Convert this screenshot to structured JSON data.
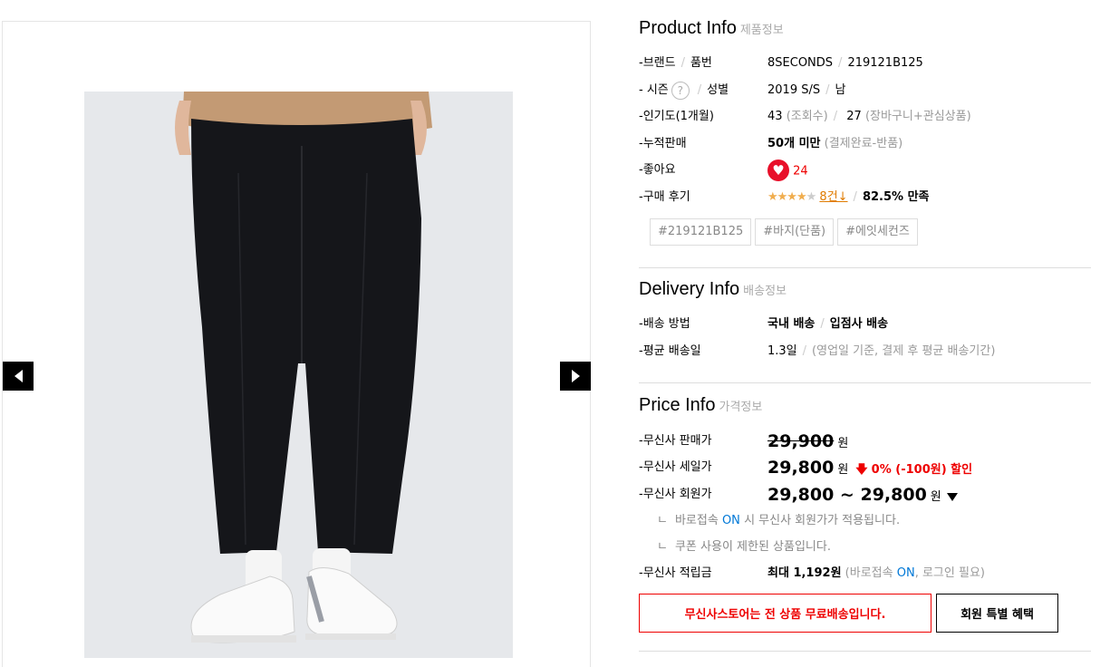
{
  "product_info": {
    "title": "Product Info",
    "subtitle": "제품정보",
    "rows": {
      "brand": {
        "label": "-브랜드",
        "label2": "품번",
        "brand": "8SECONDS",
        "code": "219121B125"
      },
      "season": {
        "label": "- 시즌",
        "help": "?",
        "label2": "성별",
        "season": "2019 S/S",
        "gender": "남"
      },
      "popularity": {
        "label": "-인기도(1개월)",
        "views": "43",
        "views_note": "(조회수)",
        "wish": "27",
        "wish_note": "(장바구니+관심상품)"
      },
      "sales": {
        "label": "-누적판매",
        "value": "50개 미만",
        "note": "(결제완료-반품)"
      },
      "likes": {
        "label": "-좋아요",
        "count": "24"
      },
      "reviews": {
        "label": "-구매 후기",
        "stars_on": "★★★★",
        "stars_off": "★",
        "count_link": "8건↓",
        "satisfaction": "82.5% 만족"
      }
    },
    "tags": [
      "#219121B125",
      "#바지(단품)",
      "#에잇세컨즈"
    ]
  },
  "delivery_info": {
    "title": "Delivery Info",
    "subtitle": "배송정보",
    "method_label": "-배송 방법",
    "method_1": "국내 배송",
    "method_2": "입점사 배송",
    "avg_label": "-평균 배송일",
    "avg_value": "1.3일",
    "avg_note": "(영업일 기준, 결제 후 평균 배송기간)"
  },
  "price_info": {
    "title": "Price Info",
    "subtitle": "가격정보",
    "list_label": "-무신사 판매가",
    "list_price": "29,900",
    "won": "원",
    "sale_label": "-무신사 세일가",
    "sale_price": "29,800",
    "discount": "0% (-100원) 할인",
    "member_label": "-무신사 회원가",
    "member_price": "29,800 ~ 29,800",
    "note1_pre": "바로접속",
    "note1_on": "ON",
    "note1_post": "시 무신사 회원가가 적용됩니다.",
    "note2": "쿠폰 사용이 제한된 상품입니다.",
    "points_label": "-무신사 적립금",
    "points_value": "최대 1,192원",
    "points_note_pre": "(바로접속",
    "points_note_on": "ON",
    "points_note_post": ", 로그인 필요)"
  },
  "buttons": {
    "free_shipping": "무신사스토어는 전 상품 무료배송입니다.",
    "member_benefit": "회원 특별 혜택"
  },
  "colors": {
    "accent_red": "#e00000",
    "link_blue": "#0078d7",
    "star": "#f0ad4e",
    "heart": "#e8102a"
  }
}
